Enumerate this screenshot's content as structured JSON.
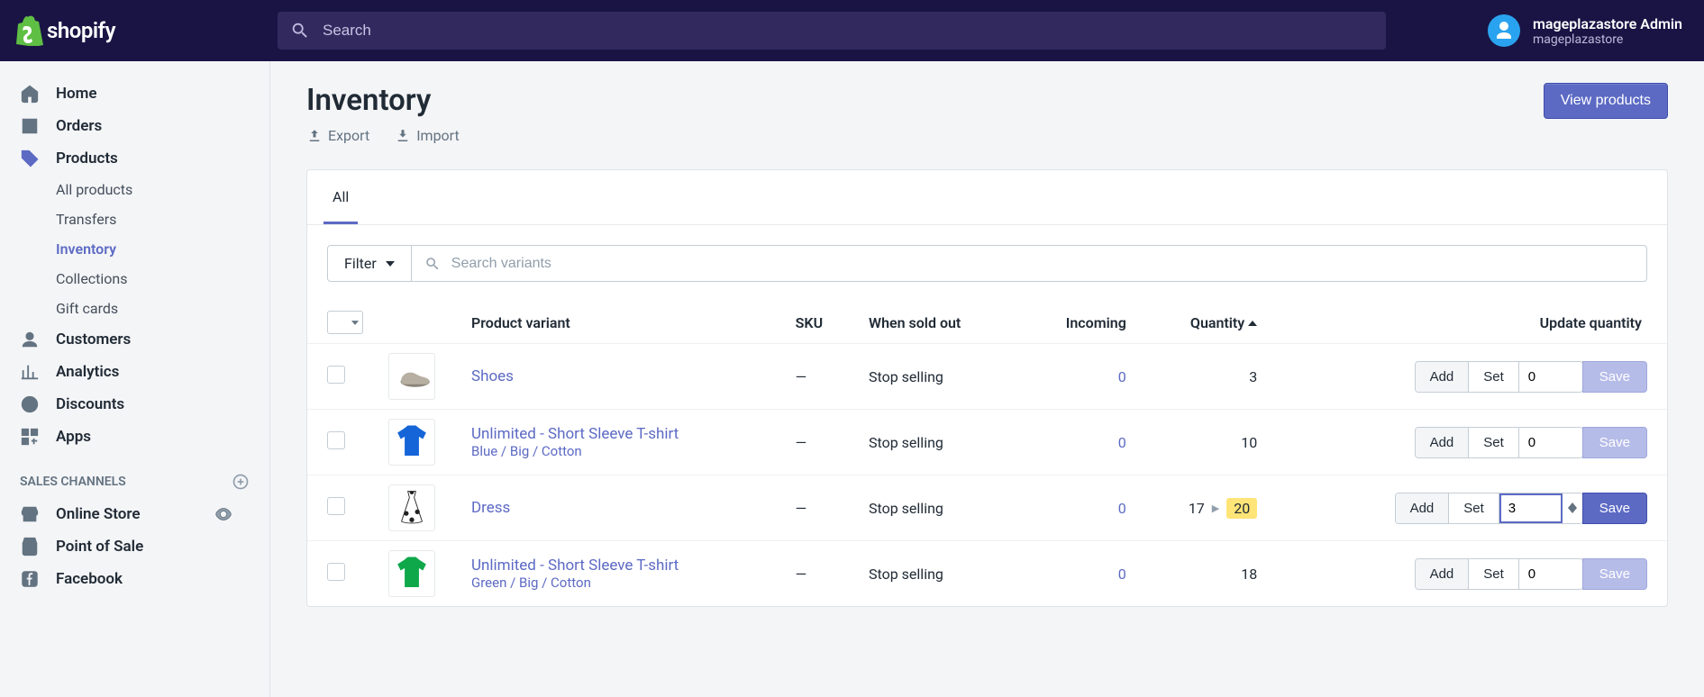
{
  "brand": "shopify",
  "search": {
    "placeholder": "Search"
  },
  "user": {
    "name": "mageplazastore Admin",
    "store": "mageplazastore"
  },
  "nav": {
    "home": "Home",
    "orders": "Orders",
    "products": "Products",
    "products_sub": {
      "all": "All products",
      "transfers": "Transfers",
      "inventory": "Inventory",
      "collections": "Collections",
      "gift": "Gift cards"
    },
    "customers": "Customers",
    "analytics": "Analytics",
    "discounts": "Discounts",
    "apps": "Apps",
    "sales_channels": "SALES CHANNELS",
    "online_store": "Online Store",
    "pos": "Point of Sale",
    "facebook": "Facebook"
  },
  "page": {
    "title": "Inventory",
    "export": "Export",
    "import": "Import",
    "view_products": "View products"
  },
  "tabs": {
    "all": "All"
  },
  "filter": {
    "label": "Filter",
    "placeholder": "Search variants"
  },
  "columns": {
    "variant": "Product variant",
    "sku": "SKU",
    "sold_out": "When sold out",
    "incoming": "Incoming",
    "quantity": "Quantity",
    "update": "Update quantity"
  },
  "update_buttons": {
    "add": "Add",
    "set": "Set",
    "save": "Save"
  },
  "rows": [
    {
      "name": "Shoes",
      "variant": "",
      "sku": "—",
      "sold_out": "Stop selling",
      "incoming": "0",
      "qty": "3",
      "input": "0",
      "changed": false,
      "thumb": "shoe"
    },
    {
      "name": "Unlimited - Short Sleeve T-shirt",
      "variant": "Blue / Big / Cotton",
      "sku": "—",
      "sold_out": "Stop selling",
      "incoming": "0",
      "qty": "10",
      "input": "0",
      "changed": false,
      "thumb": "shirt-blue"
    },
    {
      "name": "Dress",
      "variant": "",
      "sku": "—",
      "sold_out": "Stop selling",
      "incoming": "0",
      "qty_old": "17",
      "qty_new": "20",
      "input": "3",
      "changed": true,
      "thumb": "dress"
    },
    {
      "name": "Unlimited - Short Sleeve T-shirt",
      "variant": "Green / Big / Cotton",
      "sku": "—",
      "sold_out": "Stop selling",
      "incoming": "0",
      "qty": "18",
      "input": "0",
      "changed": false,
      "thumb": "shirt-green"
    }
  ]
}
